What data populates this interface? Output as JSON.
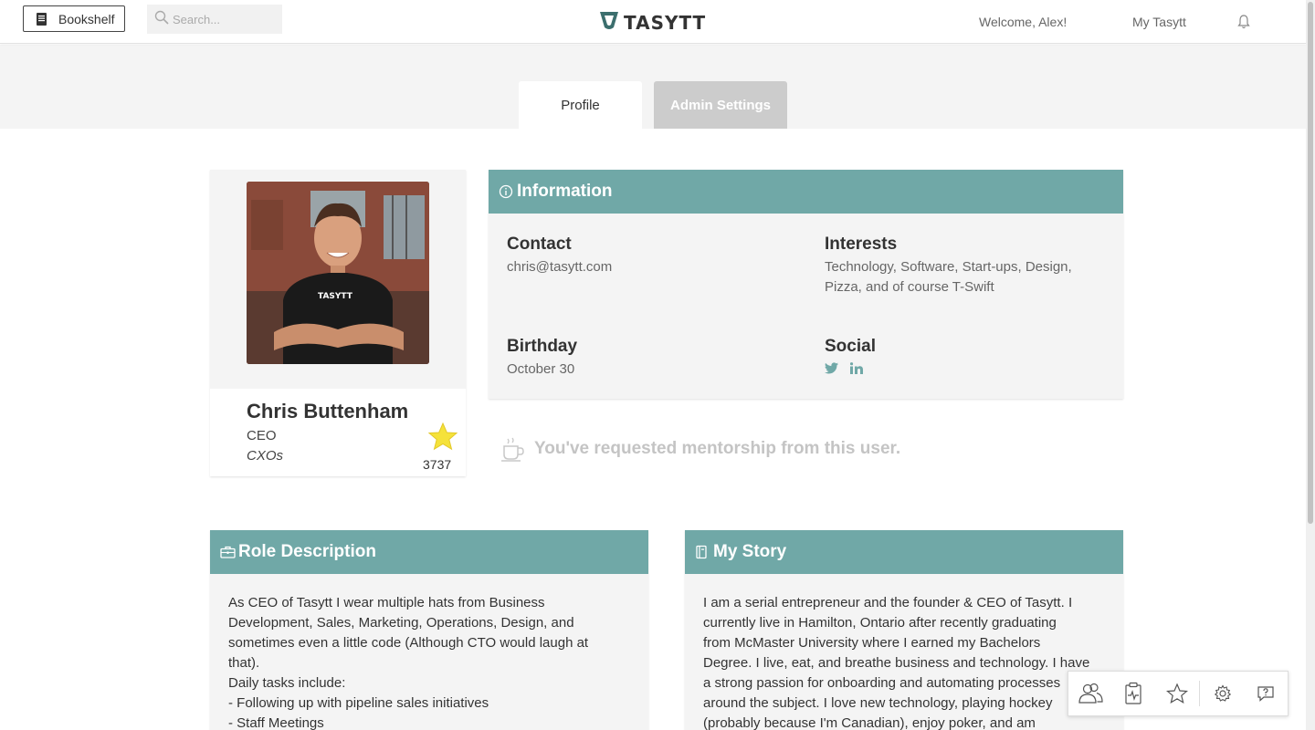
{
  "nav": {
    "bookshelf_label": "Bookshelf",
    "search_placeholder": "Search...",
    "logo_text": "TASYTT",
    "welcome": "Welcome, Alex!",
    "my_tasytt": "My Tasytt"
  },
  "tabs": [
    {
      "label": "Profile",
      "active": true
    },
    {
      "label": "Admin Settings",
      "active": false
    }
  ],
  "profile": {
    "name": "Chris Buttenham",
    "title": "CEO",
    "group": "CXOs",
    "star_count": "3737",
    "shirt_logo": "TASYTT"
  },
  "information": {
    "header": "Information",
    "contact_label": "Contact",
    "contact_value": "chris@tasytt.com",
    "interests_label": "Interests",
    "interests_line1": "Technology, Software, Start-ups, Design,",
    "interests_line2": "Pizza, and of course T-Swift",
    "birthday_label": "Birthday",
    "birthday_value": "October 30",
    "social_label": "Social",
    "social_icons": [
      "twitter-icon",
      "linkedin-icon"
    ]
  },
  "mentorship": {
    "text": "You've requested mentorship from this user."
  },
  "role_description": {
    "header": "Role Description",
    "lines": [
      "As CEO of Tasytt I wear multiple hats from Business",
      "Development, Sales, Marketing, Operations, Design, and",
      "sometimes even a little code (Although CTO would laugh at",
      "that).",
      "Daily tasks include:",
      "- Following up with pipeline sales initiatives",
      "- Staff Meetings"
    ]
  },
  "my_story": {
    "header": "My Story",
    "lines": [
      "I am a serial entrepreneur and the founder & CEO of Tasytt. I",
      "currently live in Hamilton, Ontario after recently graduating",
      "from McMaster University where I earned my Bachelors",
      "Degree. I live, eat, and breathe business and technology. I have",
      "a strong passion for onboarding and automating processes",
      "around the subject. I love new technology, playing hockey",
      "(probably because I'm Canadian), enjoy poker, and am"
    ]
  },
  "toolbar_icons": [
    "people-icon",
    "clipboard-pulse-icon",
    "star-icon",
    "gear-icon",
    "help-icon"
  ],
  "colors": {
    "accent": "#70a8a7",
    "panel_bg": "#f4f4f4",
    "tab_inactive": "#cccccc",
    "star": "#f5e23a",
    "muted_text": "#c4c4c4"
  }
}
